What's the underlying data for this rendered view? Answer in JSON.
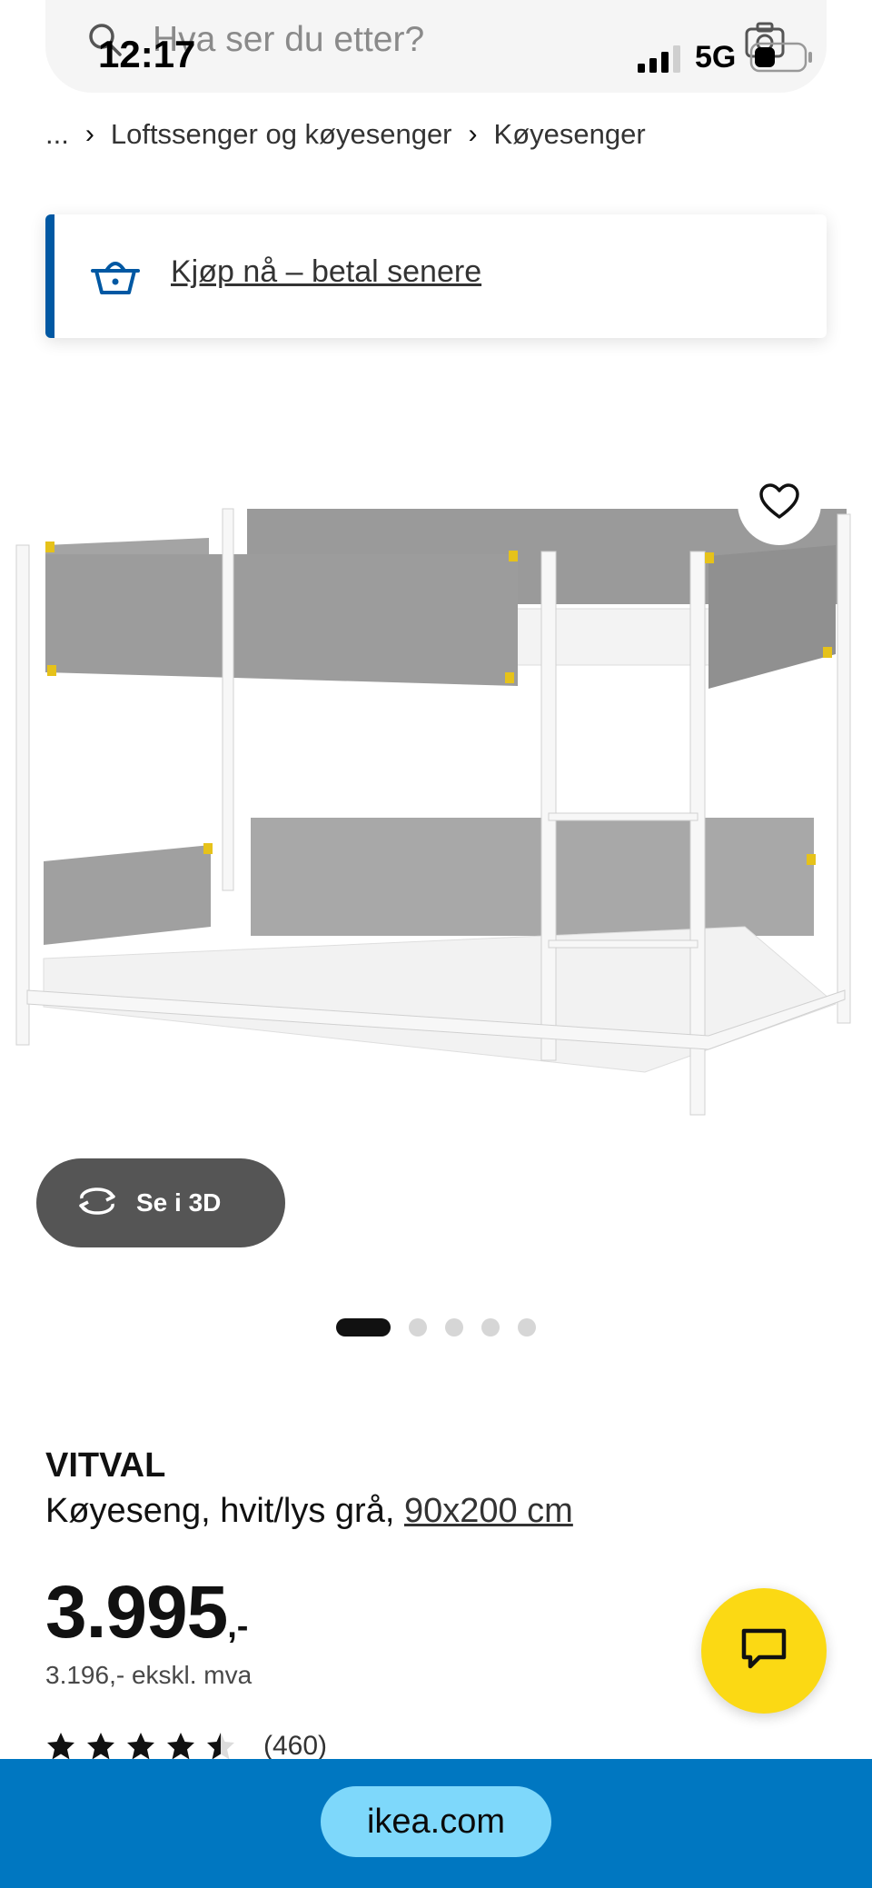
{
  "status_bar": {
    "time": "12:17",
    "network": "5G"
  },
  "search": {
    "placeholder": "Hva ser du etter?"
  },
  "breadcrumb": {
    "items": [
      "...",
      "Loftssenger og køyesenger",
      "Køyesenger"
    ],
    "separator": "›"
  },
  "promo": {
    "link_text": "Kjøp nå – betal senere"
  },
  "gallery": {
    "see_3d_label": "Se i 3D",
    "dot_count": 5,
    "active_index": 0
  },
  "product": {
    "name": "VITVAL",
    "description_prefix": "Køyeseng, hvit/lys grå,",
    "size_link": "90x200 cm",
    "price_main": "3.995",
    "price_suffix": ",-",
    "price_ex_vat": "3.196,- ekskl. mva",
    "rating_stars": 4.5,
    "review_count": "(460)"
  },
  "browser": {
    "url": "ikea.com"
  },
  "colors": {
    "brand_blue": "#0058a3",
    "url_bar_blue": "#0077c1",
    "chat_yellow": "#fbd914",
    "see3d_gray": "#555555"
  },
  "icons": {
    "search": "search-icon",
    "camera": "camera-icon",
    "basket": "basket-icon",
    "favorite": "heart-icon",
    "rotate_3d": "rotate-3d-icon",
    "chat": "chat-icon",
    "star": "star-icon"
  }
}
